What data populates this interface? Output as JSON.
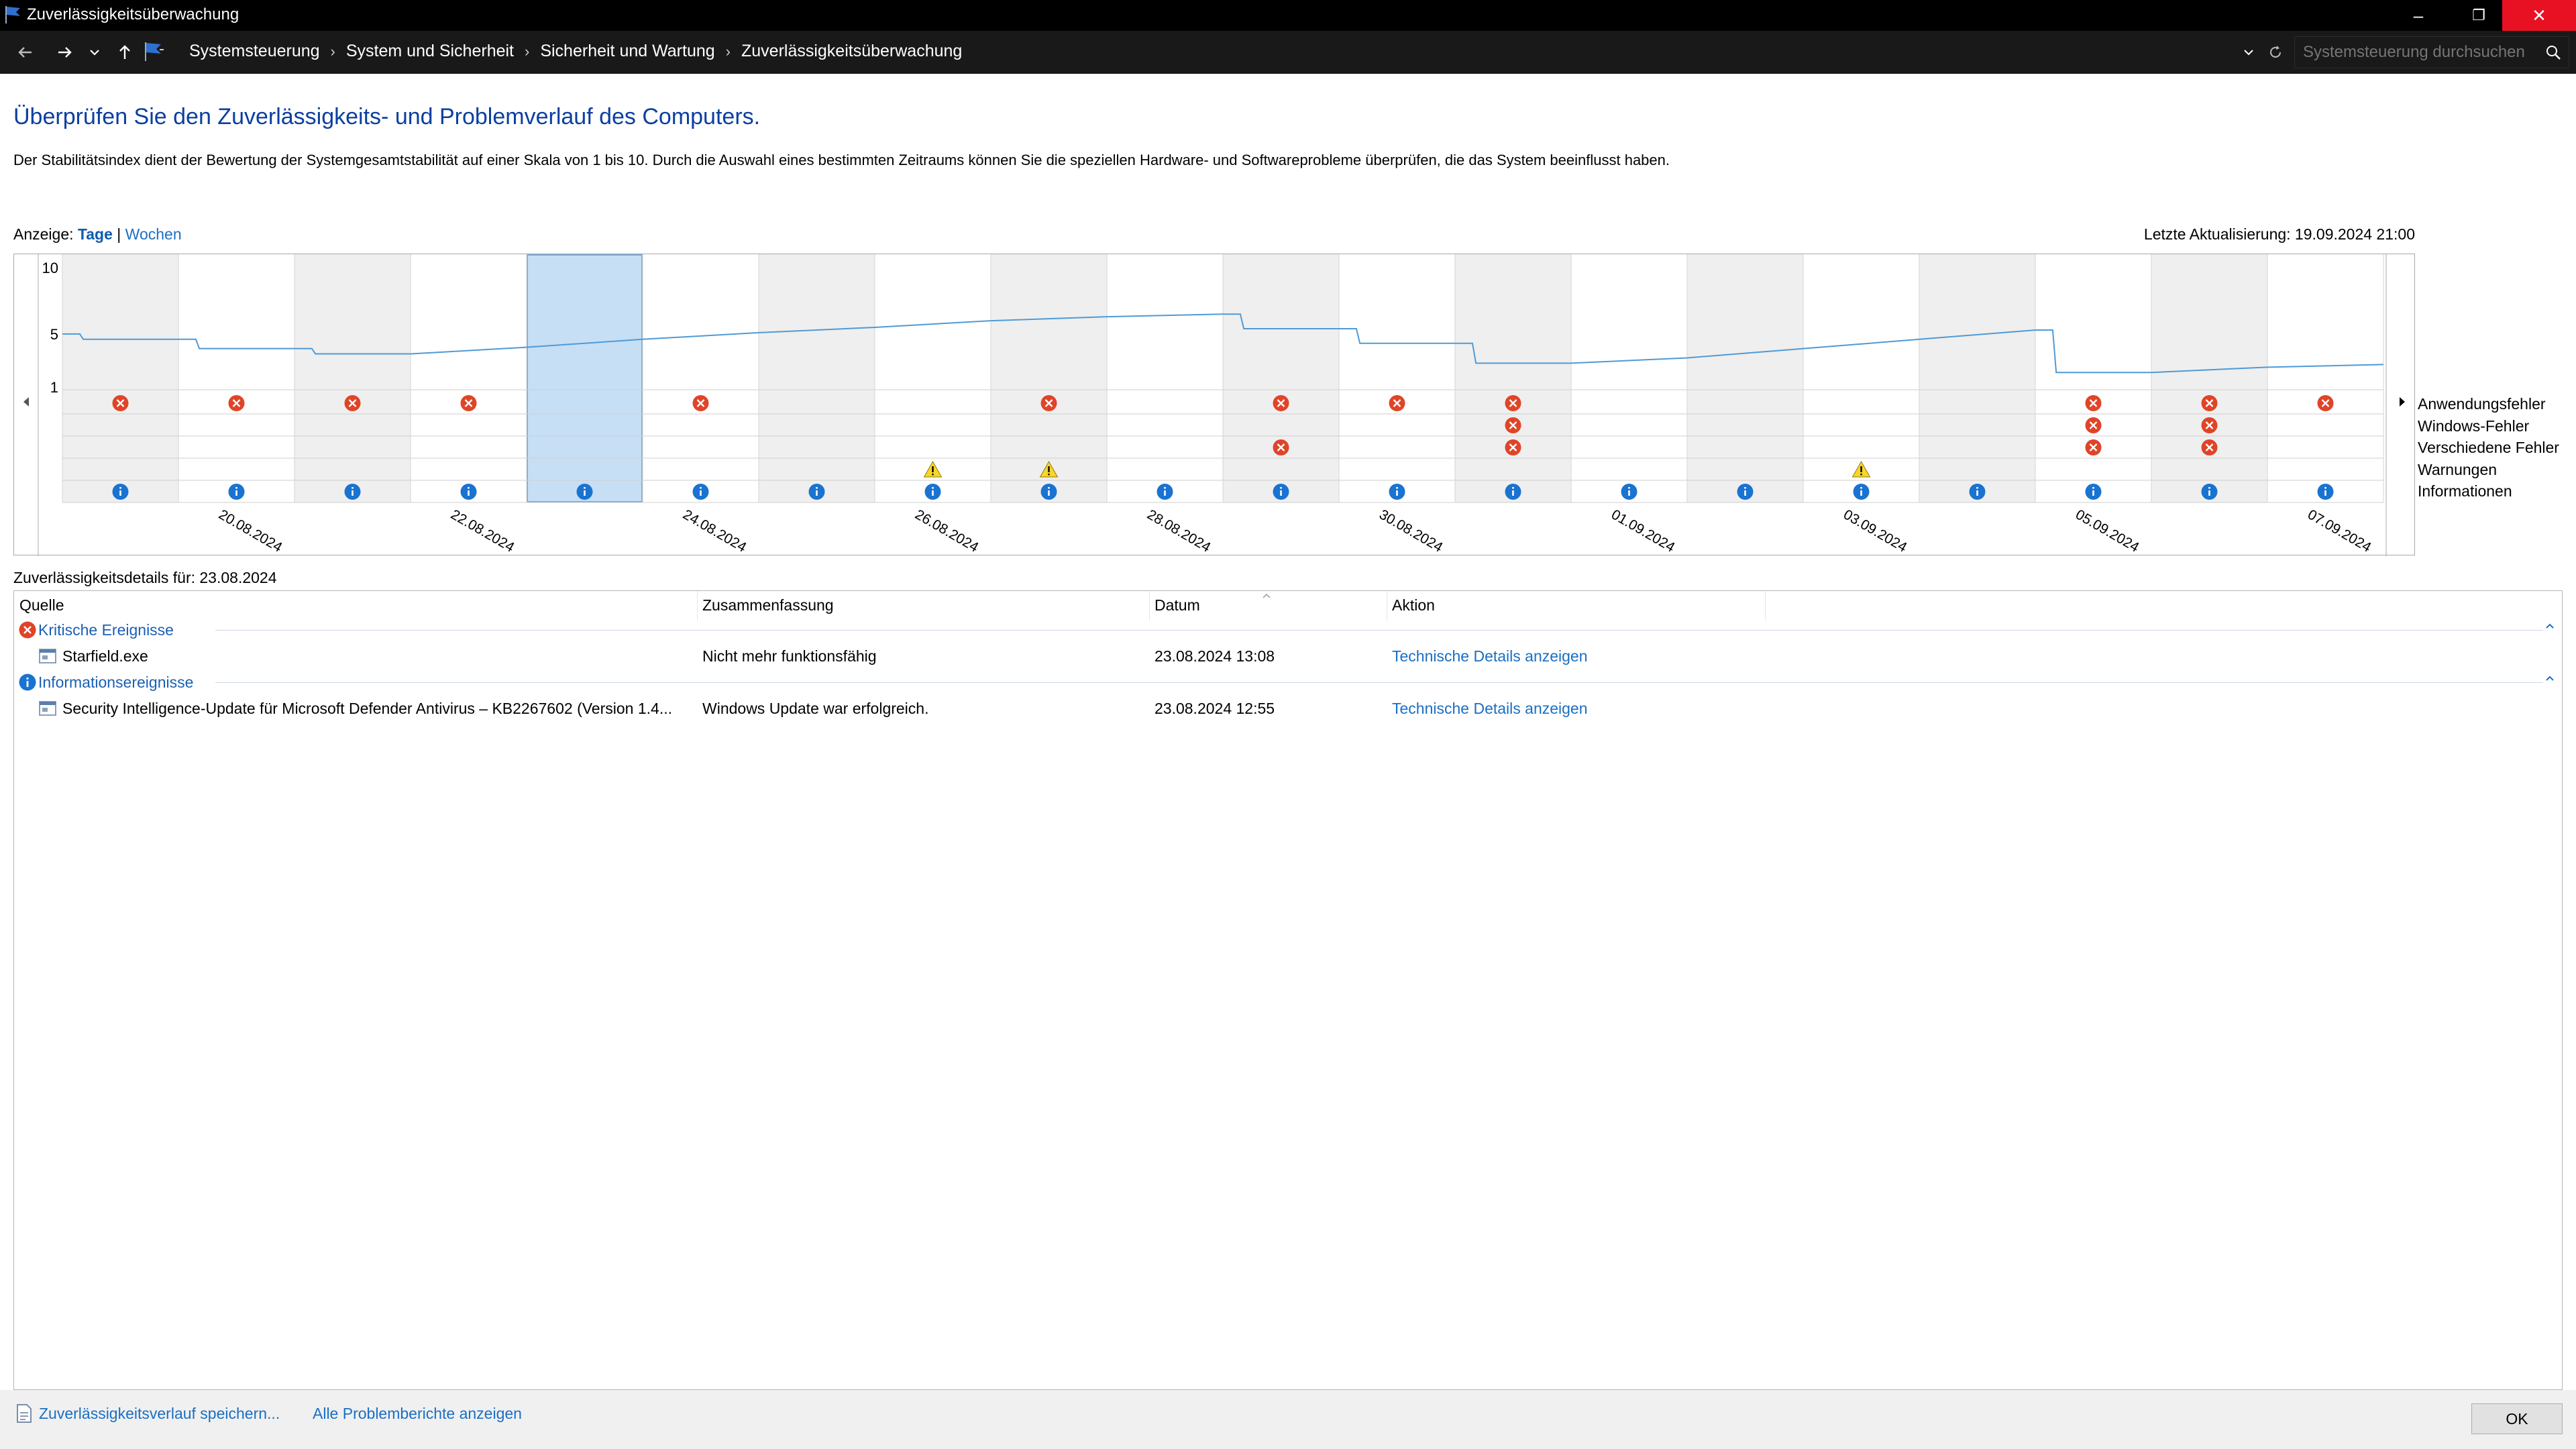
{
  "window": {
    "title": "Zuverlässigkeitsüberwachung",
    "minimize_glyph": "–",
    "restore_glyph": "❐",
    "close_glyph": "✕"
  },
  "nav": {
    "breadcrumbs": [
      "Systemsteuerung",
      "System und Sicherheit",
      "Sicherheit und Wartung",
      "Zuverlässigkeitsüberwachung"
    ],
    "search_placeholder": "Systemsteuerung durchsuchen"
  },
  "page": {
    "heading": "Überprüfen Sie den Zuverlässigkeits- und Problemverlauf des Computers.",
    "description": "Der Stabilitätsindex dient der Bewertung der Systemgesamtstabilität auf einer Skala von 1 bis 10. Durch die Auswahl eines bestimmten Zeitraums können Sie die speziellen Hardware- und Softwareprobleme überprüfen, die das System beeinflusst haben.",
    "view_label": "Anzeige:",
    "view_days": "Tage",
    "view_sep": "|",
    "view_weeks": "Wochen",
    "last_update": "Letzte Aktualisierung: 19.09.2024 21:00"
  },
  "chart_data": {
    "type": "line",
    "y_ticks": [
      "10",
      "5",
      "1"
    ],
    "ylim": [
      1,
      10
    ],
    "selected_day": "23.08.2024",
    "days": [
      "19.08.2024",
      "20.08.2024",
      "21.08.2024",
      "22.08.2024",
      "23.08.2024",
      "24.08.2024",
      "25.08.2024",
      "26.08.2024",
      "27.08.2024",
      "28.08.2024",
      "29.08.2024",
      "30.08.2024",
      "31.08.2024",
      "01.09.2024",
      "02.09.2024",
      "03.09.2024",
      "04.09.2024",
      "05.09.2024",
      "06.09.2024",
      "07.09.2024"
    ],
    "date_labels": [
      "20.08.2024",
      "22.08.2024",
      "24.08.2024",
      "26.08.2024",
      "28.08.2024",
      "30.08.2024",
      "01.09.2024",
      "03.09.2024",
      "05.09.2024",
      "07.09.2024"
    ],
    "stability_index": [
      5.0,
      4.6,
      3.9,
      3.5,
      4.0,
      4.6,
      5.1,
      5.5,
      6.0,
      6.3,
      6.5,
      5.4,
      4.3,
      2.8,
      3.2,
      3.9,
      4.6,
      5.3,
      2.1,
      2.5
    ],
    "stability_index_end": 2.7,
    "event_rows": [
      "Anwendungsfehler",
      "Windows-Fehler",
      "Verschiedene Fehler",
      "Warnungen",
      "Informationen"
    ],
    "events": {
      "Anwendungsfehler": [
        1,
        1,
        1,
        1,
        0,
        1,
        0,
        0,
        1,
        0,
        1,
        1,
        1,
        0,
        0,
        0,
        0,
        1,
        1,
        1
      ],
      "Windows-Fehler": [
        0,
        0,
        0,
        0,
        0,
        0,
        0,
        0,
        0,
        0,
        0,
        0,
        1,
        0,
        0,
        0,
        0,
        1,
        1,
        0
      ],
      "Verschiedene Fehler": [
        0,
        0,
        0,
        0,
        0,
        0,
        0,
        0,
        0,
        0,
        1,
        0,
        1,
        0,
        0,
        0,
        0,
        1,
        1,
        0
      ],
      "Warnungen": [
        0,
        0,
        0,
        0,
        0,
        0,
        0,
        1,
        1,
        0,
        0,
        0,
        0,
        0,
        0,
        1,
        0,
        0,
        0,
        0
      ],
      "Informationen": [
        1,
        1,
        1,
        1,
        1,
        1,
        1,
        1,
        1,
        1,
        1,
        1,
        1,
        1,
        1,
        1,
        1,
        1,
        1,
        1
      ]
    },
    "colors": {
      "line": "#4f9ad6",
      "selected": "#c6dff5",
      "shaded": "#efefef",
      "error": "#e04428",
      "info": "#1a73d0",
      "warning": "#f7d52a"
    }
  },
  "details": {
    "label": "Zuverlässigkeitsdetails für: 23.08.2024",
    "columns": [
      "Quelle",
      "Zusammenfassung",
      "Datum",
      "Aktion"
    ],
    "groups": [
      {
        "name": "Kritische Ereignisse",
        "icon": "error-icon",
        "rows": [
          {
            "source": "Starfield.exe",
            "summary": "Nicht mehr funktionsfähig",
            "date": "23.08.2024 13:08",
            "action": "Technische Details anzeigen"
          }
        ]
      },
      {
        "name": "Informationsereignisse",
        "icon": "info-icon",
        "rows": [
          {
            "source": "Security Intelligence-Update für Microsoft Defender Antivirus – KB2267602 (Version 1.4...",
            "summary": "Windows Update war erfolgreich.",
            "date": "23.08.2024 12:55",
            "action": "Technische Details anzeigen"
          }
        ]
      }
    ]
  },
  "footer": {
    "save_link": "Zuverlässigkeitsverlauf speichern...",
    "reports_link": "Alle Problemberichte anzeigen",
    "ok_label": "OK"
  }
}
